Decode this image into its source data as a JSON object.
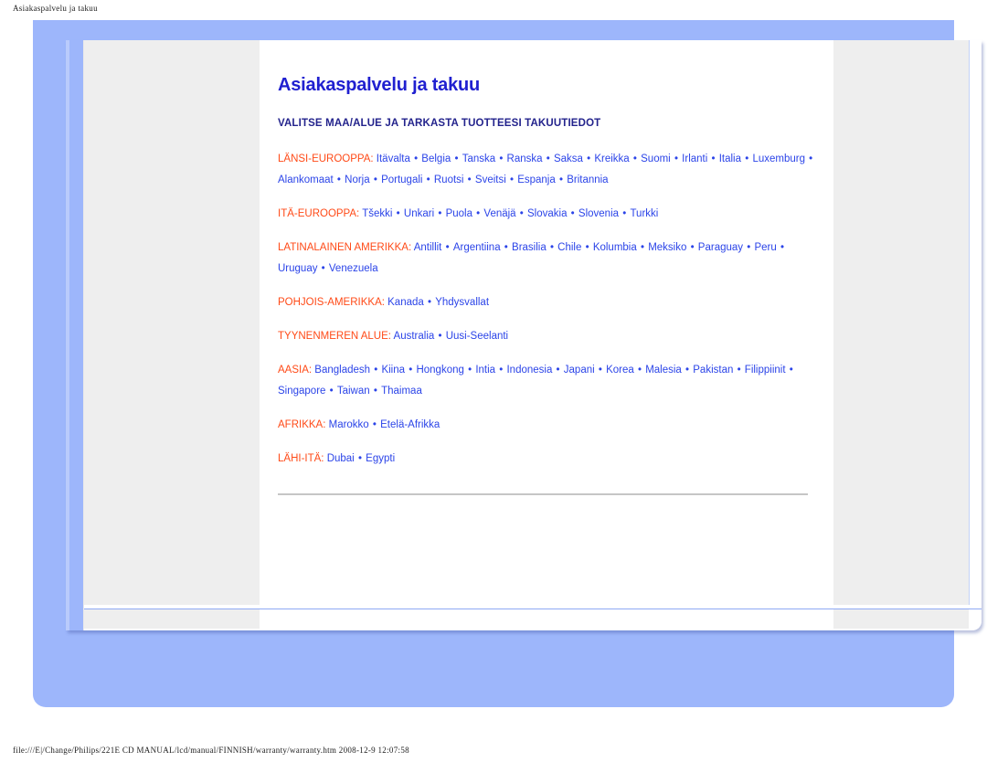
{
  "print": {
    "header": "Asiakaspalvelu ja takuu",
    "footer": "file:///E|/Change/Philips/221E CD MANUAL/lcd/manual/FINNISH/warranty/warranty.htm 2008-12-9 12:07:58"
  },
  "document": {
    "title": "Asiakaspalvelu ja takuu",
    "subtitle": "VALITSE MAA/ALUE JA TARKASTA TUOTTEESI TAKUUTIEDOT",
    "separator": "•",
    "regions": [
      {
        "label": "LÄNSI-EUROOPPA:",
        "countries": [
          "Itävalta",
          "Belgia",
          "Tanska",
          "Ranska",
          "Saksa",
          "Kreikka",
          "Suomi",
          "Irlanti",
          "Italia",
          "Luxemburg",
          "Alankomaat",
          "Norja",
          "Portugali",
          "Ruotsi",
          "Sveitsi",
          "Espanja",
          "Britannia"
        ]
      },
      {
        "label": "ITÄ-EUROOPPA:",
        "countries": [
          "Tšekki",
          "Unkari",
          "Puola",
          "Venäjä",
          "Slovakia",
          "Slovenia",
          "Turkki"
        ]
      },
      {
        "label": "LATINALAINEN AMERIKKA:",
        "countries": [
          "Antillit",
          "Argentiina",
          "Brasilia",
          "Chile",
          "Kolumbia",
          "Meksiko",
          "Paraguay",
          "Peru",
          "Uruguay",
          "Venezuela"
        ]
      },
      {
        "label": "POHJOIS-AMERIKKA:",
        "countries": [
          "Kanada",
          "Yhdysvallat"
        ]
      },
      {
        "label": "TYYNENMEREN ALUE:",
        "countries": [
          "Australia",
          "Uusi-Seelanti"
        ]
      },
      {
        "label": "AASIA:",
        "countries": [
          "Bangladesh",
          "Kiina",
          "Hongkong",
          "Intia",
          "Indonesia",
          "Japani",
          "Korea",
          "Malesia",
          "Pakistan",
          "Filippiinit",
          "Singapore",
          "Taiwan",
          "Thaimaa"
        ]
      },
      {
        "label": "AFRIKKA:",
        "countries": [
          "Marokko",
          "Etelä-Afrikka"
        ]
      },
      {
        "label": "LÄHI-ITÄ:",
        "countries": [
          "Dubai",
          "Egypti"
        ]
      }
    ]
  },
  "colors": {
    "title": "#2020d0",
    "subtitle": "#23238c",
    "region_label": "#ff4a17",
    "link": "#2b44e8",
    "canvas": "#9db6fb",
    "panel": "#eeeeee"
  }
}
